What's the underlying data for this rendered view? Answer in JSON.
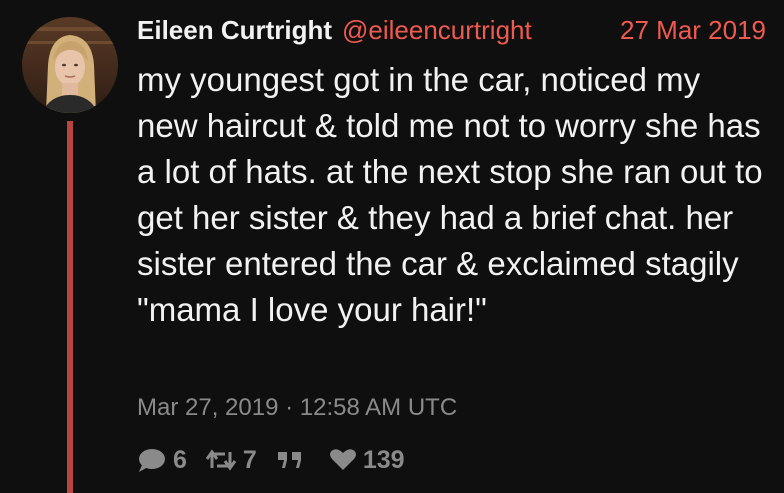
{
  "tweet": {
    "fullname": "Eileen Curtright",
    "username": "@eileencurtright",
    "date": "27 Mar 2019",
    "text": "my youngest got in the car, noticed my new haircut & told me not to worry she has a lot of hats. at the next stop she ran out to get her sister & they had a brief chat. her sister entered the car & exclaimed stagily \"mama I love your hair!\"",
    "timestamp": "Mar 27, 2019 · 12:58 AM UTC",
    "stats": {
      "replies": "6",
      "retweets": "7",
      "quotes": "",
      "likes": "139"
    }
  },
  "icons": {
    "reply": "speech-bubble-icon",
    "retweet": "retweet-arrows-icon",
    "quote": "quote-icon",
    "like": "heart-icon"
  },
  "colors": {
    "background": "#0f0f0f",
    "accent": "#ee5a4f",
    "thread_line": "#b9453e",
    "muted": "#8a8a8a",
    "text": "#f2f2f2"
  }
}
